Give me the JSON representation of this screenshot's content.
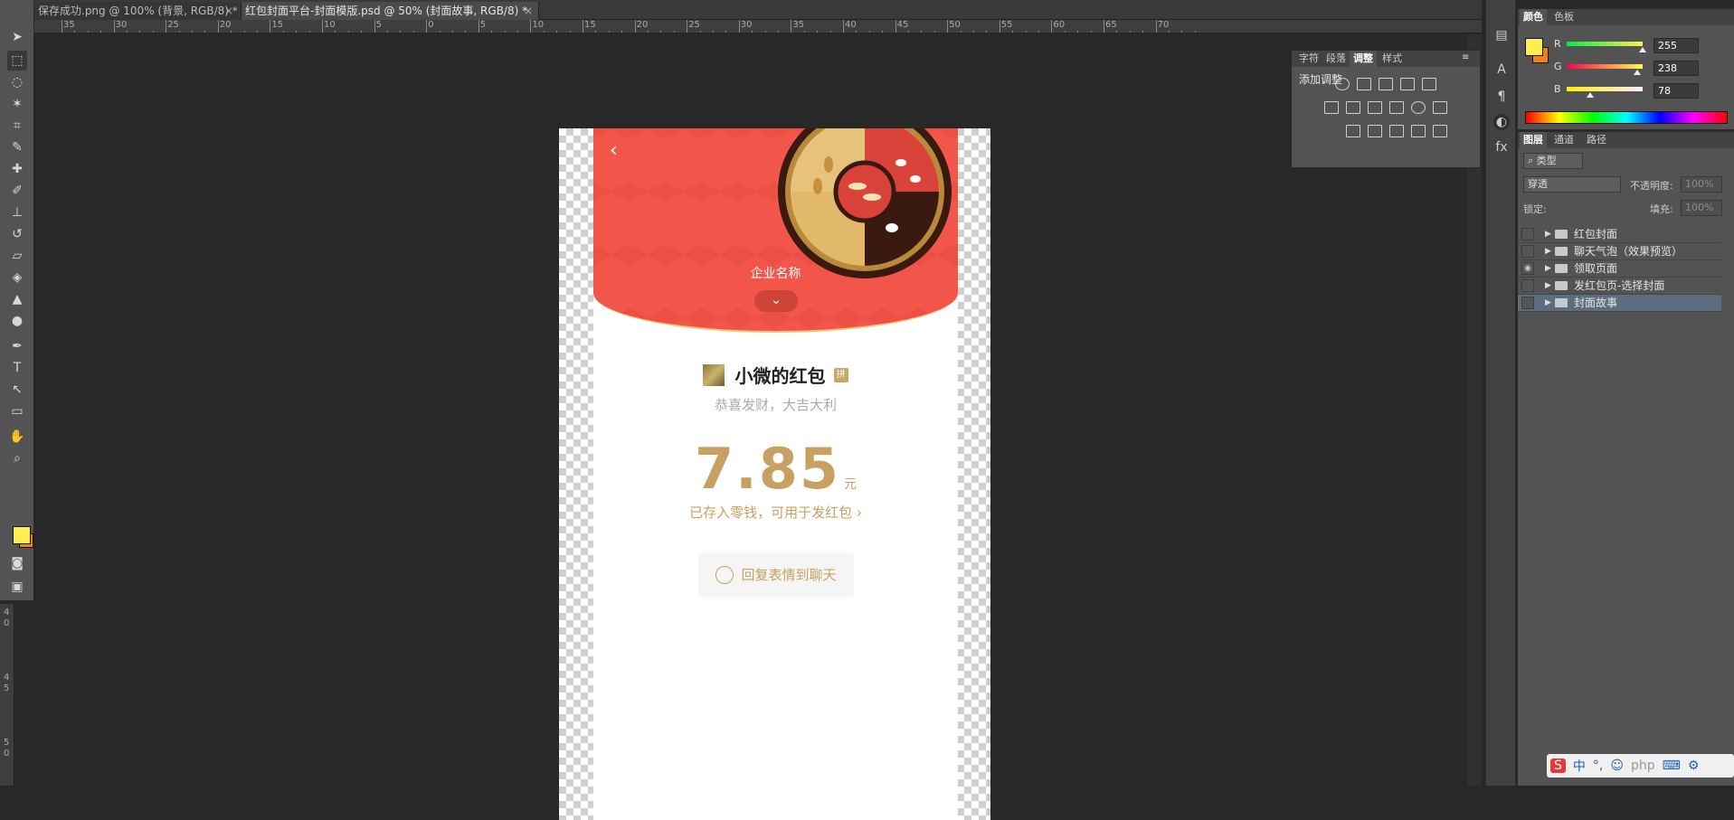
{
  "tabs": [
    {
      "label": "保存成功.png @ 100% (背景, RGB/8) *",
      "active": false
    },
    {
      "label": "红包封面平台-封面模版.psd @ 50% (封面故事, RGB/8) *",
      "active": true
    }
  ],
  "ruler": {
    "top_labels": [
      "35",
      "30",
      "25",
      "20",
      "15",
      "10",
      "5",
      "0",
      "5",
      "10",
      "15",
      "20",
      "25",
      "30",
      "35",
      "40",
      "45",
      "50",
      "55",
      "60",
      "65",
      "70"
    ],
    "left_labels": [
      "4",
      "0",
      "4",
      "5",
      "5",
      "0"
    ]
  },
  "tools": [
    "move-tool",
    "marquee-tool",
    "lasso-tool",
    "magic-wand-tool",
    "crop-tool",
    "eyedropper-tool",
    "healing-brush-tool",
    "brush-tool",
    "clone-stamp-tool",
    "history-brush-tool",
    "eraser-tool",
    "paint-bucket-tool",
    "blur-tool",
    "dodge-tool",
    "pen-tool",
    "type-tool",
    "path-selection-tool",
    "shape-tool",
    "hand-tool",
    "zoom-tool"
  ],
  "foreground_color": "#ffee4e",
  "background_color": "#f07f1e",
  "canvas": {
    "company_name": "企业名称",
    "sender_name": "小微的红包",
    "sender_badge": "拼",
    "wishes": "恭喜发财，大吉大利",
    "amount": "7.85",
    "currency": "元",
    "saved_link": "已存入零钱，可用于发红包",
    "reply_button": "回复表情到聊天",
    "cover_color": "#f2564a",
    "accent_color": "#c8a162"
  },
  "adjustments_panel": {
    "tabs": [
      "字符",
      "段落",
      "调整",
      "样式"
    ],
    "active_tab": "调整",
    "title": "添加调整"
  },
  "color_panel": {
    "tabs": [
      "颜色",
      "色板"
    ],
    "r": "255",
    "g": "238",
    "b": "78",
    "r_label": "R",
    "g_label": "G",
    "b_label": "B",
    "r_level": 1.0,
    "g_level": 0.93,
    "b_level": 0.31
  },
  "layers_panel": {
    "tabs": [
      "图层",
      "通道",
      "路径"
    ],
    "filter": "类型",
    "blend_mode": "穿透",
    "opacity_label": "不透明度:",
    "opacity_value": "100%",
    "lock_label": "锁定:",
    "fill_label": "填充:",
    "fill_value": "100%",
    "layers": [
      {
        "name": "红包封面",
        "visible": false,
        "selected": false
      },
      {
        "name": "聊天气泡（效果预览）",
        "visible": false,
        "selected": false
      },
      {
        "name": "领取页面",
        "visible": true,
        "selected": false
      },
      {
        "name": "发红包页-选择封面",
        "visible": false,
        "selected": false
      },
      {
        "name": "封面故事",
        "visible": false,
        "selected": true
      }
    ]
  },
  "ime": {
    "label1": "中",
    "label2": "°,",
    "watermark": "php"
  }
}
